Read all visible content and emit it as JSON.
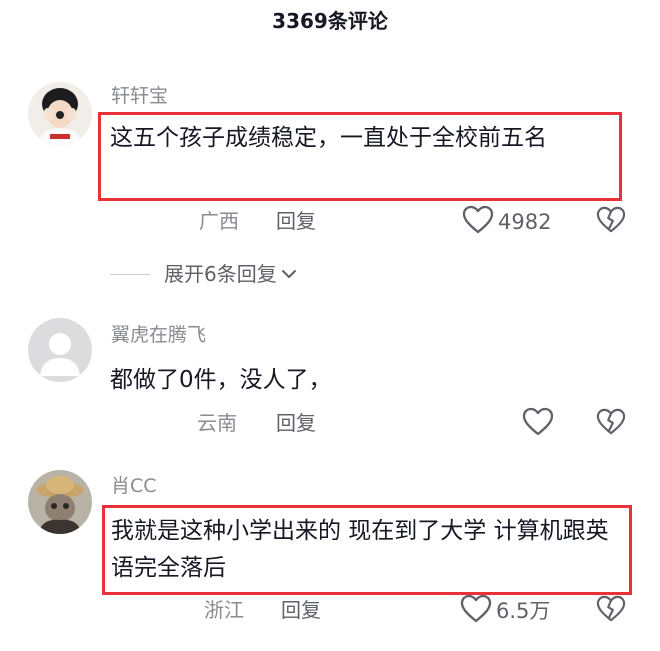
{
  "header": {
    "title": "3369条评论"
  },
  "comments": [
    {
      "username": "轩轩宝",
      "text": "这五个孩子成绩稳定，一直处于全校前五名",
      "location": "广西",
      "reply_label": "回复",
      "likes": "4982",
      "highlighted": true,
      "expand_label": "展开6条回复"
    },
    {
      "username": "翼虎在腾飞",
      "text": "都做了0件，没人了，",
      "location": "云南",
      "reply_label": "回复",
      "likes": "",
      "highlighted": false
    },
    {
      "username": "肖CC",
      "text": "我就是这种小学出来的 现在到了大学 计算机跟英语完全落后",
      "location": "浙江",
      "reply_label": "回复",
      "likes": "6.5万",
      "highlighted": true
    }
  ],
  "colors": {
    "highlight_border": "#e8323a",
    "text_primary": "#161823",
    "text_secondary": "#8a8b91"
  },
  "icons": [
    "heart-icon",
    "broken-heart-icon",
    "chevron-down-icon"
  ]
}
